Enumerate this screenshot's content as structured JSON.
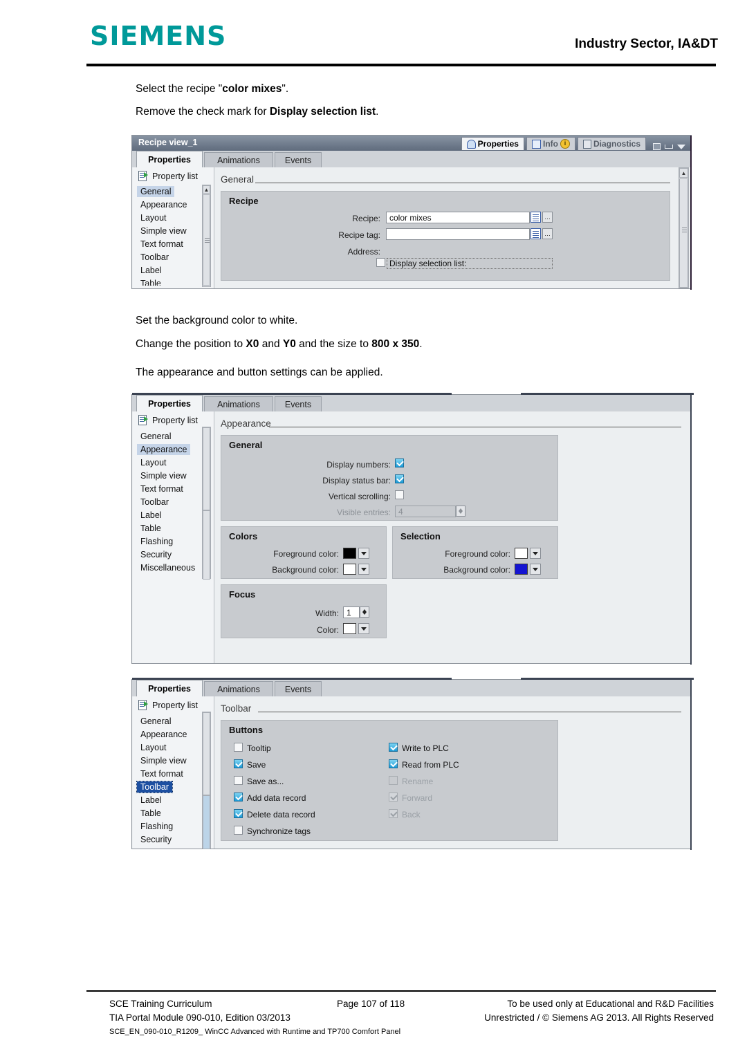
{
  "header": {
    "logo": "SIEMENS",
    "title": "Industry Sector, IA&DT"
  },
  "instructions": {
    "line1_a": "Select the recipe \"",
    "line1_b": "color mixes",
    "line1_c": "\".",
    "line2_a": "Remove the check mark for ",
    "line2_b": "Display selection list",
    "line2_c": ".",
    "line3": "Set the background color to white.",
    "line4_a": "Change the position to ",
    "line4_b": "X0",
    "line4_c": " and ",
    "line4_d": "Y0",
    "line4_e": " and the size to ",
    "line4_f": "800 x 350",
    "line4_g": ".",
    "line5": "The appearance and button settings can be applied."
  },
  "panel1": {
    "window_title": "Recipe view_1",
    "header_tabs": [
      {
        "label": "Properties",
        "icon": "properties-icon",
        "active": true
      },
      {
        "label": "Info",
        "icon": "info-icon",
        "active": false
      },
      {
        "label": "Diagnostics",
        "icon": "diagnostics-icon",
        "active": false
      }
    ],
    "tabs": [
      "Properties",
      "Animations",
      "Events"
    ],
    "active_tab": "Properties",
    "nav_header": "Property list",
    "nav_items": [
      "General",
      "Appearance",
      "Layout",
      "Simple view",
      "Text format",
      "Toolbar",
      "Label",
      "Table"
    ],
    "selected_nav": "General",
    "section_title": "General",
    "group_title": "Recipe",
    "fields": {
      "recipe_label": "Recipe:",
      "recipe_value": "color mixes",
      "recipe_tag_label": "Recipe tag:",
      "recipe_tag_value": "",
      "address_label": "Address:",
      "display_selection_list_label": "Display selection list:",
      "display_selection_list_checked": false
    }
  },
  "panel2": {
    "tabs": [
      "Properties",
      "Animations",
      "Events"
    ],
    "active_tab": "Properties",
    "nav_header": "Property list",
    "nav_items": [
      "General",
      "Appearance",
      "Layout",
      "Simple view",
      "Text format",
      "Toolbar",
      "Label",
      "Table",
      "Flashing",
      "Security",
      "Miscellaneous"
    ],
    "selected_nav": "Appearance",
    "section_title": "Appearance",
    "general": {
      "title": "General",
      "rows": [
        {
          "label": "Display numbers:",
          "checked": true,
          "enabled": true
        },
        {
          "label": "Display status bar:",
          "checked": true,
          "enabled": true
        },
        {
          "label": "Vertical scrolling:",
          "checked": false,
          "enabled": true
        }
      ],
      "visible_entries_label": "Visible entries:",
      "visible_entries_value": "4",
      "visible_entries_enabled": false
    },
    "colors": {
      "title": "Colors",
      "foreground_label": "Foreground color:",
      "foreground_hex": "#000000",
      "background_label": "Background color:",
      "background_hex": "#ffffff"
    },
    "selection": {
      "title": "Selection",
      "foreground_label": "Foreground color:",
      "foreground_hex": "#ffffff",
      "background_label": "Background color:",
      "background_hex": "#1414d2"
    },
    "focus": {
      "title": "Focus",
      "width_label": "Width:",
      "width_value": "1",
      "color_label": "Color:",
      "color_hex": "#ffffff"
    }
  },
  "panel3": {
    "tabs": [
      "Properties",
      "Animations",
      "Events"
    ],
    "active_tab": "Properties",
    "nav_header": "Property list",
    "nav_items": [
      "General",
      "Appearance",
      "Layout",
      "Simple view",
      "Text format",
      "Toolbar",
      "Label",
      "Table",
      "Flashing",
      "Security"
    ],
    "selected_nav": "Toolbar",
    "section_title": "Toolbar",
    "buttons": {
      "title": "Buttons",
      "left_column": [
        {
          "label": "Tooltip",
          "checked": false,
          "enabled": true
        },
        {
          "label": "Save",
          "checked": true,
          "enabled": true
        },
        {
          "label": "Save as...",
          "checked": false,
          "enabled": true
        },
        {
          "label": "Add data record",
          "checked": true,
          "enabled": true
        },
        {
          "label": "Delete data record",
          "checked": true,
          "enabled": true
        },
        {
          "label": "Synchronize tags",
          "checked": false,
          "enabled": true
        }
      ],
      "right_column": [
        {
          "label": "Write to PLC",
          "checked": true,
          "enabled": true
        },
        {
          "label": "Read from PLC",
          "checked": true,
          "enabled": true
        },
        {
          "label": "Rename",
          "checked": false,
          "enabled": false
        },
        {
          "label": "Forward",
          "checked": true,
          "enabled": false
        },
        {
          "label": "Back",
          "checked": true,
          "enabled": false
        }
      ]
    }
  },
  "footer": {
    "left1": "SCE Training Curriculum",
    "left2": "TIA Portal Module 090-010, Edition 03/2013",
    "left3": "SCE_EN_090-010_R1209_ WinCC Advanced with Runtime and TP700 Comfort Panel",
    "center": "Page 107 of 118",
    "right1": "To be used only at Educational and R&D Facilities",
    "right2": "Unrestricted / © Siemens AG 2013. All Rights Reserved"
  },
  "colors": {
    "brand_teal": "#009999",
    "titlebar": "#6d7a8c",
    "selection_blue": "#1c4fa1",
    "checkbox_blue": "#29abe2"
  }
}
